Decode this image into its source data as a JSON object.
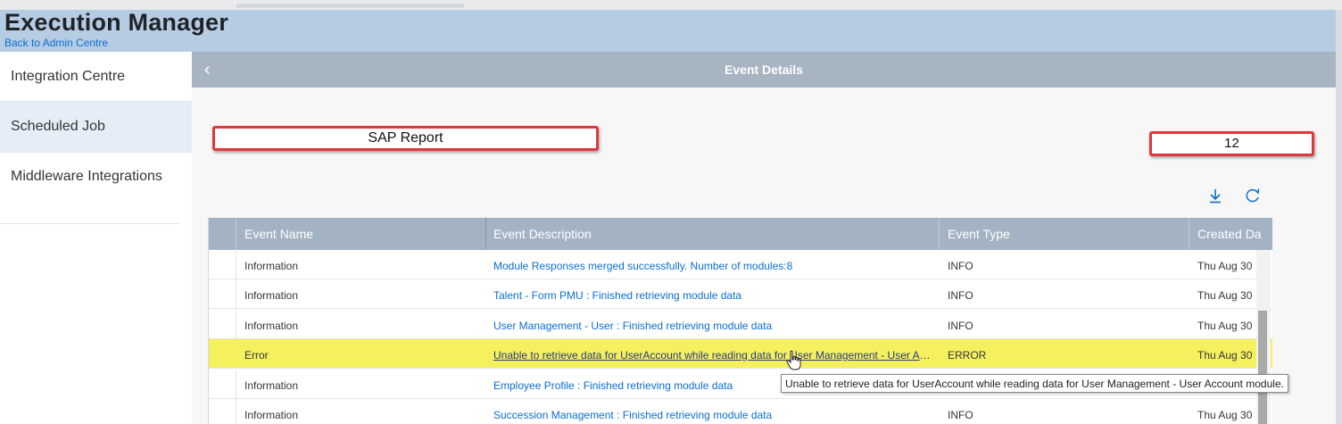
{
  "app": {
    "title": "Execution Manager",
    "back_link": "Back to Admin Centre"
  },
  "sidebar": {
    "items": [
      {
        "label": "Integration Centre",
        "selected": false
      },
      {
        "label": "Scheduled Job",
        "selected": true
      },
      {
        "label": "Middleware Integrations",
        "selected": false
      }
    ]
  },
  "page": {
    "title": "Event Details",
    "back_icon": "chevron-left-icon"
  },
  "fields": {
    "process_name": "SAP Report",
    "count": "12"
  },
  "toolbar": {
    "download_icon": "download-icon",
    "refresh_icon": "refresh-icon"
  },
  "table": {
    "columns": [
      "Event Name",
      "Event Description",
      "Event Type",
      "Created Da"
    ],
    "rows": [
      {
        "name": "Information",
        "description": "Module Responses merged successfully. Number of modules:8",
        "type": "INFO",
        "created": "Thu Aug 30"
      },
      {
        "name": "Information",
        "description": "Talent - Form PMU : Finished retrieving module data",
        "type": "INFO",
        "created": "Thu Aug 30"
      },
      {
        "name": "Information",
        "description": "User Management - User : Finished retrieving module data",
        "type": "INFO",
        "created": "Thu Aug 30"
      },
      {
        "name": "Error",
        "description": "Unable to retrieve data for UserAccount while reading data for User Management - User Ac...",
        "type": "ERROR",
        "created": "Thu Aug 30"
      },
      {
        "name": "Information",
        "description": "Employee Profile : Finished retrieving module data",
        "type": "INFO",
        "created": ""
      },
      {
        "name": "Information",
        "description": "Succession Management : Finished retrieving module data",
        "type": "INFO",
        "created": "Thu Aug 30"
      }
    ]
  },
  "tooltip": {
    "text": "Unable to retrieve data for UserAccount while reading data for User Management - User Account module."
  },
  "colors": {
    "shell": "#b6cce3",
    "header": "#a7b4c1",
    "accent": "#0a6ed1",
    "highlight": "#f5f15e",
    "annotation_box": "#e0373c"
  }
}
